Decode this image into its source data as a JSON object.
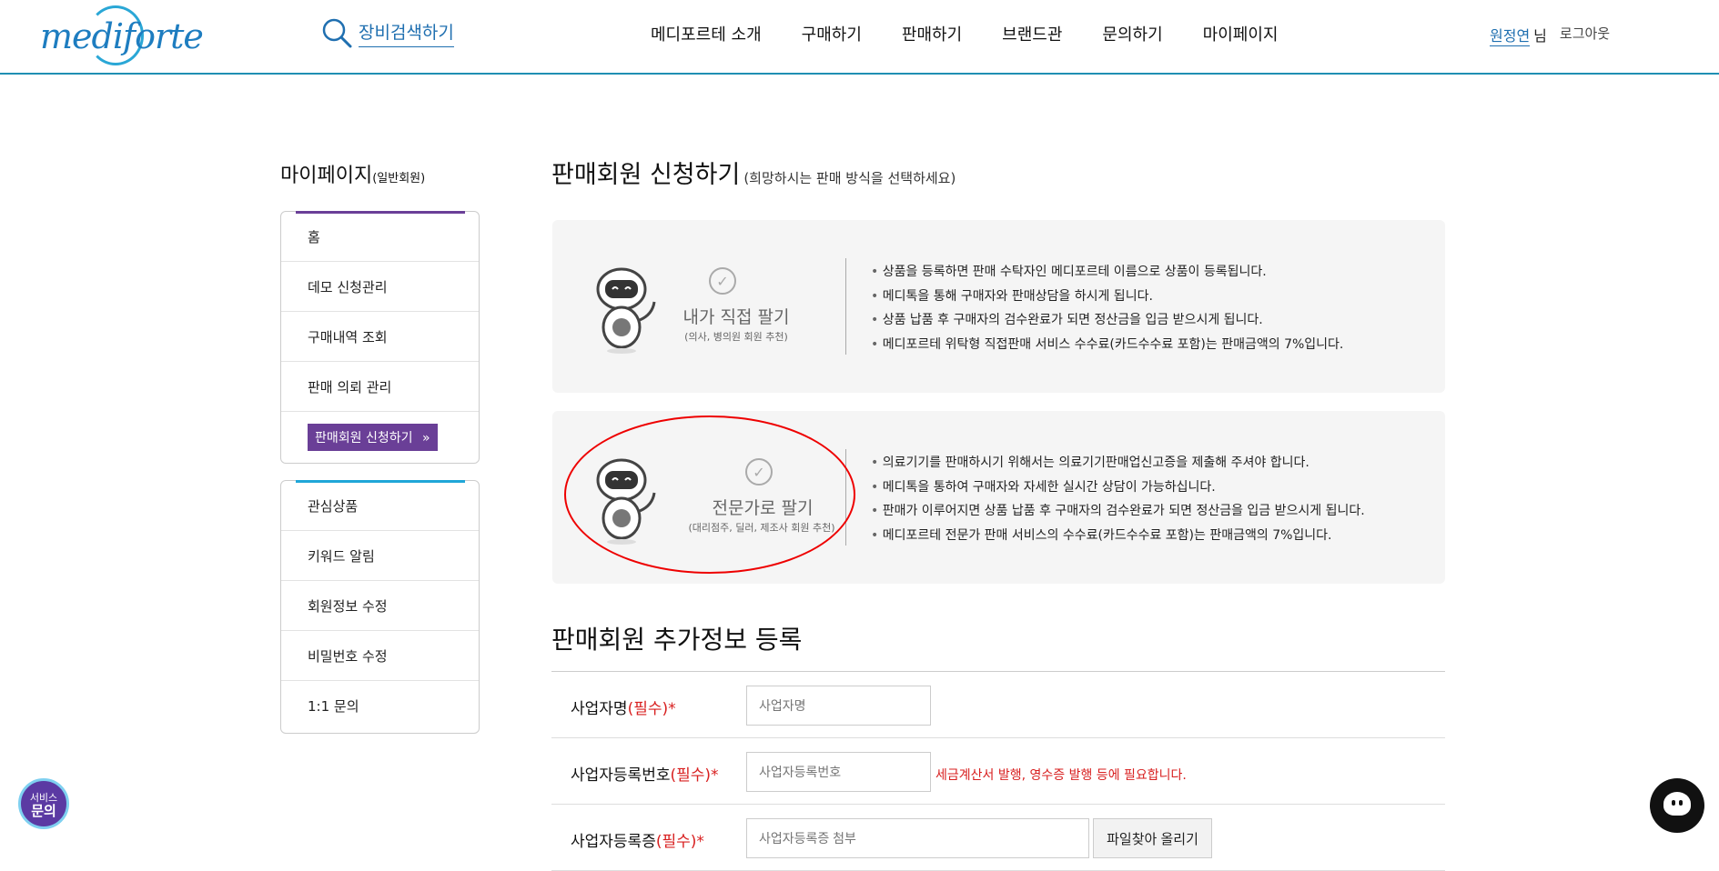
{
  "header": {
    "logo_text": "mediforte",
    "search_label": "장비검색하기",
    "nav": [
      "메디포르테 소개",
      "구매하기",
      "판매하기",
      "브랜드관",
      "문의하기",
      "마이페이지"
    ],
    "user_name": "원정연",
    "user_suffix": "님",
    "logout": "로그아웃"
  },
  "sidebar": {
    "title": "마이페이지",
    "title_sub": "(일반회원)",
    "group1": [
      "홈",
      "데모 신청관리",
      "구매내역 조회",
      "판매 의뢰 관리",
      "판매회원 신청하기"
    ],
    "group2": [
      "관심상품",
      "키워드 알림",
      "회원정보 수정",
      "비밀번호 수정",
      "1:1 문의"
    ]
  },
  "main": {
    "title": "판매회원 신청하기",
    "title_sub": "(희망하시는 판매 방식을 선택하세요)",
    "option1": {
      "title": "내가 직접 팔기",
      "sub": "(의사, 병의원 회원 추천)",
      "bullets": [
        "상품을 등록하면 판매 수탁자인 메디포르테 이름으로 상품이 등록됩니다.",
        "메디톡을 통해 구매자와 판매상담을 하시게 됩니다.",
        "상품 납품 후 구매자의 검수완료가 되면 정산금을 입금 받으시게 됩니다.",
        "메디포르테 위탁형 직접판매 서비스 수수료(카드수수료 포함)는 판매금액의 7%입니다."
      ]
    },
    "option2": {
      "title": "전문가로 팔기",
      "sub": "(대리점주, 딜러, 제조사 회원 추천)",
      "bullets": [
        "의료기기를 판매하시기 위해서는 의료기기판매업신고증을 제출해 주셔야 합니다.",
        "메디톡을 통하여 구매자와 자세한 실시간 상담이 가능하십니다.",
        "판매가 이루어지면 상품 납품 후 구매자의 검수완료가 되면 정산금을 입금 받으시게 됩니다.",
        "메디포르테 전문가 판매 서비스의 수수료(카드수수료 포함)는 판매금액의 7%입니다."
      ]
    },
    "section_title": "판매회원 추가정보 등록",
    "form": {
      "company_label": "사업자명",
      "company_req": "(필수)*",
      "company_placeholder": "사업자명",
      "regno_label": "사업자등록번호",
      "regno_req": "(필수)*",
      "regno_placeholder": "사업자등록번호",
      "regno_hint": "세금계산서 발행, 영수증 발행 등에 필요합니다.",
      "cert_label": "사업자등록증",
      "cert_req": "(필수)*",
      "cert_placeholder": "사업자등록증 첨부",
      "cert_button": "파일찾아 올리기"
    }
  },
  "floating": {
    "service_line1": "서비스",
    "service_line2": "문의"
  },
  "colors": {
    "accent": "#1f8fb3",
    "purple": "#6a3f97",
    "required": "#d81e1e"
  }
}
